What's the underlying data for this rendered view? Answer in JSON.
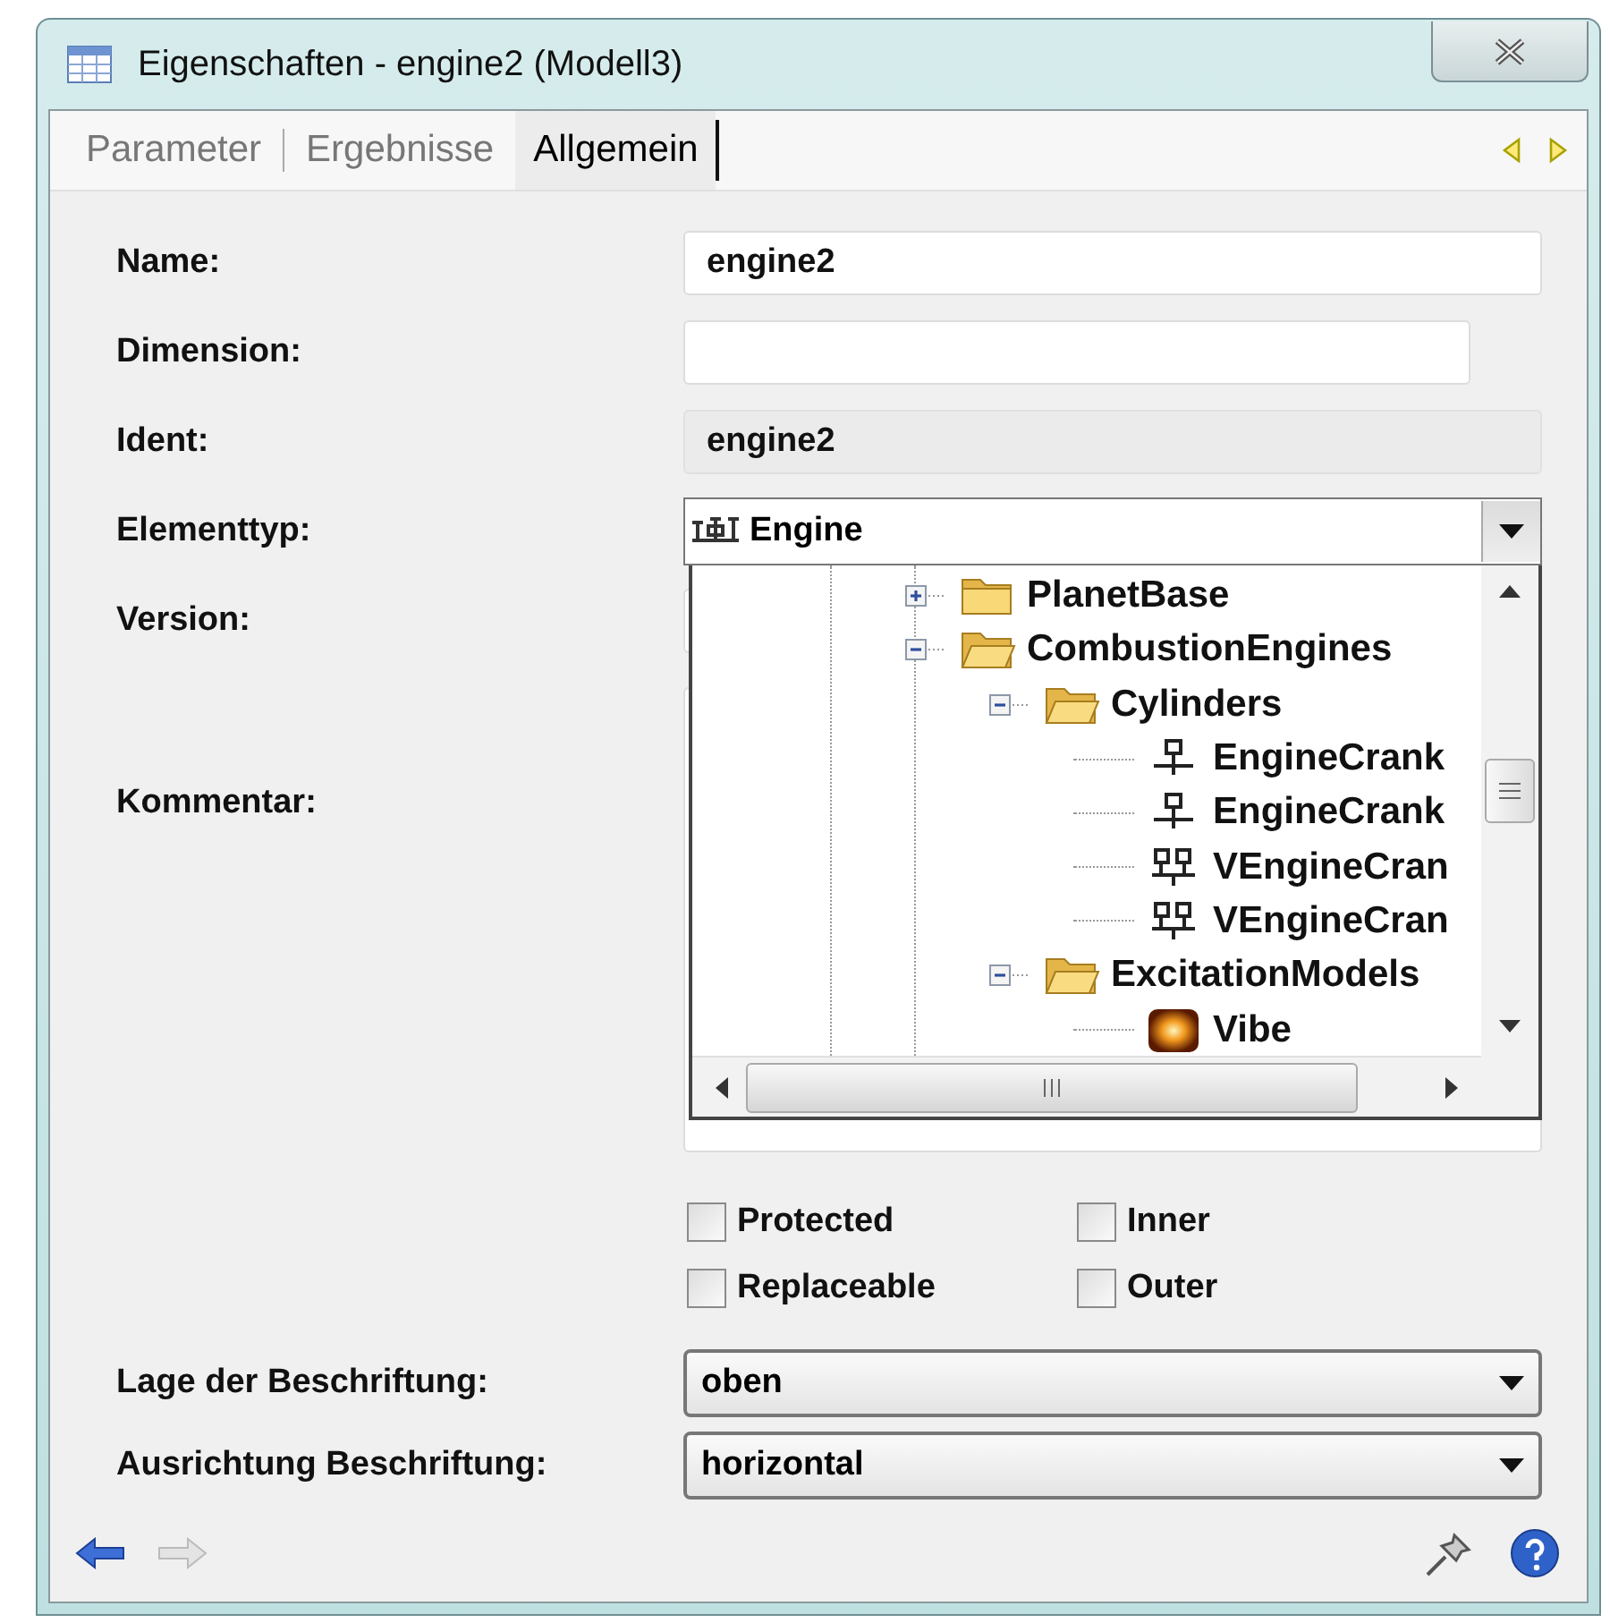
{
  "window": {
    "title": "Eigenschaften - engine2 (Modell3)"
  },
  "tabs": [
    {
      "label": "Parameter",
      "selected": false
    },
    {
      "label": "Ergebnisse",
      "selected": false
    },
    {
      "label": "Allgemein",
      "selected": true
    }
  ],
  "form": [
    {
      "kind": "input",
      "label": "Name:",
      "value": "engine2"
    },
    {
      "kind": "narrow",
      "label": "Dimension:"
    },
    {
      "kind": "readonly",
      "label": "Ident:",
      "value": "engine2"
    },
    {
      "kind": "combo",
      "label": "Elementtyp:",
      "value": "Engine",
      "open": true
    },
    {
      "kind": "covered",
      "label": "Version:"
    },
    {
      "kind": "textarea",
      "label": "Kommentar:"
    }
  ],
  "tree": [
    {
      "label": "PlanetBase",
      "kind": "folder",
      "expanded": false
    },
    {
      "label": "CombustionEngines",
      "kind": "folder",
      "expanded": true,
      "children": [
        {
          "label": "Cylinders",
          "kind": "folder",
          "expanded": true,
          "children": [
            {
              "label": "EngineCrank",
              "kind": "crank"
            },
            {
              "label": "EngineCrank",
              "kind": "crank"
            },
            {
              "label": "VEngineCran",
              "kind": "vcrank"
            },
            {
              "label": "VEngineCran",
              "kind": "vcrank"
            }
          ]
        },
        {
          "label": "ExcitationModels",
          "kind": "folder",
          "expanded": true,
          "children": [
            {
              "label": "Vibe",
              "kind": "flame"
            }
          ]
        }
      ]
    }
  ],
  "checkboxes": [
    {
      "label": "Protected",
      "checked": false
    },
    {
      "label": "Inner",
      "checked": false
    },
    {
      "label": "Replaceable",
      "checked": false
    },
    {
      "label": "Outer",
      "checked": false
    }
  ],
  "selects": [
    {
      "label": "Lage der Beschriftung:",
      "value": "oben"
    },
    {
      "label": "Ausrichtung Beschriftung:",
      "value": "horizontal"
    }
  ]
}
